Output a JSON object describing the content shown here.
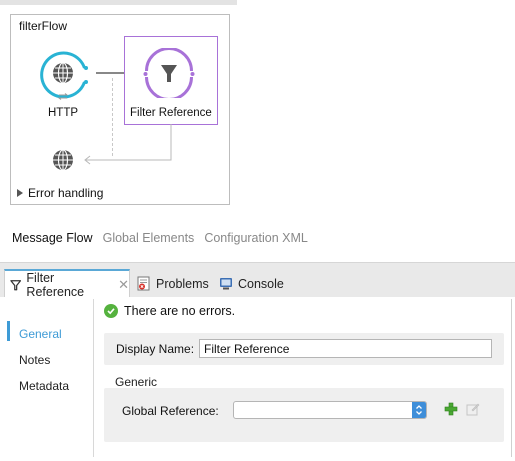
{
  "flow": {
    "name": "filterFlow",
    "nodes": {
      "http_label": "HTTP",
      "filter_label": "Filter Reference"
    },
    "error_handling_label": "Error handling"
  },
  "editor_tabs": [
    {
      "label": "Message Flow",
      "active": true
    },
    {
      "label": "Global Elements",
      "active": false
    },
    {
      "label": "Configuration XML",
      "active": false
    }
  ],
  "panel_tabs": [
    {
      "label": "Filter Reference",
      "icon": "filter-icon",
      "active": true
    },
    {
      "label": "Problems",
      "icon": "problems-icon",
      "active": false
    },
    {
      "label": "Console",
      "icon": "console-icon",
      "active": false
    }
  ],
  "sidebar": {
    "items": [
      {
        "label": "General",
        "active": true
      },
      {
        "label": "Notes",
        "active": false
      },
      {
        "label": "Metadata",
        "active": false
      }
    ]
  },
  "status": {
    "message": "There are no errors."
  },
  "form": {
    "display_name_label": "Display Name:",
    "display_name_value": "Filter Reference",
    "generic_section": "Generic",
    "global_reference_label": "Global Reference:",
    "global_reference_value": ""
  },
  "colors": {
    "http_accent": "#29b3d4",
    "filter_accent": "#a872d8",
    "selection_border": "#a872d8",
    "active_blue": "#3e9bd6",
    "ok_green": "#55b23e"
  }
}
